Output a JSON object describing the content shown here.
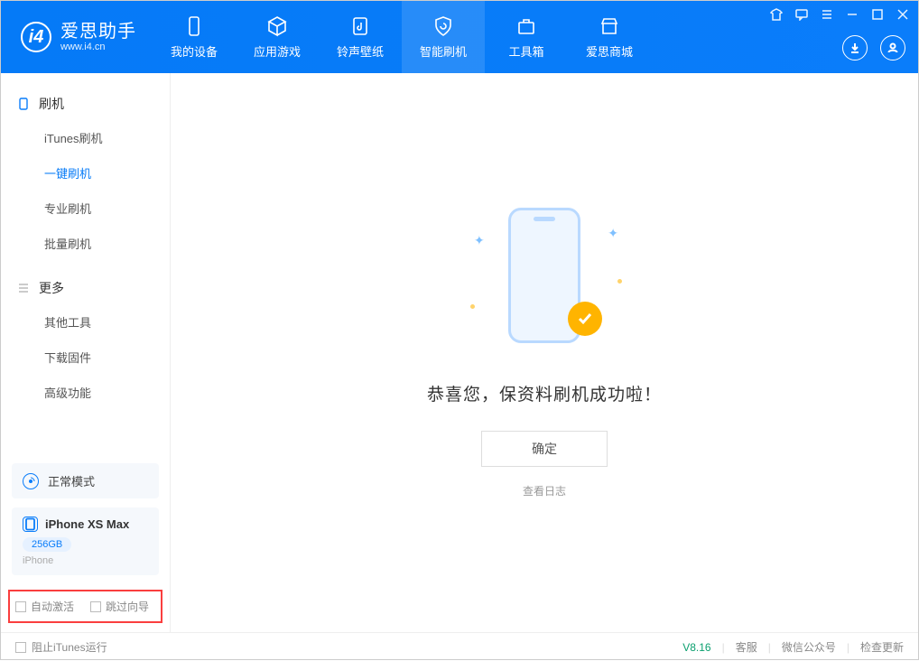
{
  "app": {
    "name": "爱思助手",
    "url": "www.i4.cn"
  },
  "header": {
    "tabs": [
      {
        "label": "我的设备"
      },
      {
        "label": "应用游戏"
      },
      {
        "label": "铃声壁纸"
      },
      {
        "label": "智能刷机",
        "active": true
      },
      {
        "label": "工具箱"
      },
      {
        "label": "爱思商城"
      }
    ]
  },
  "sidebar": {
    "section_flash": "刷机",
    "flash_items": [
      {
        "label": "iTunes刷机"
      },
      {
        "label": "一键刷机",
        "active": true
      },
      {
        "label": "专业刷机"
      },
      {
        "label": "批量刷机"
      }
    ],
    "section_more": "更多",
    "more_items": [
      {
        "label": "其他工具"
      },
      {
        "label": "下载固件"
      },
      {
        "label": "高级功能"
      }
    ],
    "mode_label": "正常模式",
    "device": {
      "name": "iPhone XS Max",
      "capacity": "256GB",
      "type": "iPhone"
    },
    "opt_auto_activate": "自动激活",
    "opt_skip_guide": "跳过向导"
  },
  "main": {
    "success_msg": "恭喜您，保资料刷机成功啦！",
    "ok_btn": "确定",
    "view_log": "查看日志"
  },
  "footer": {
    "block_itunes": "阻止iTunes运行",
    "version": "V8.16",
    "link_support": "客服",
    "link_wechat": "微信公众号",
    "link_update": "检查更新"
  }
}
